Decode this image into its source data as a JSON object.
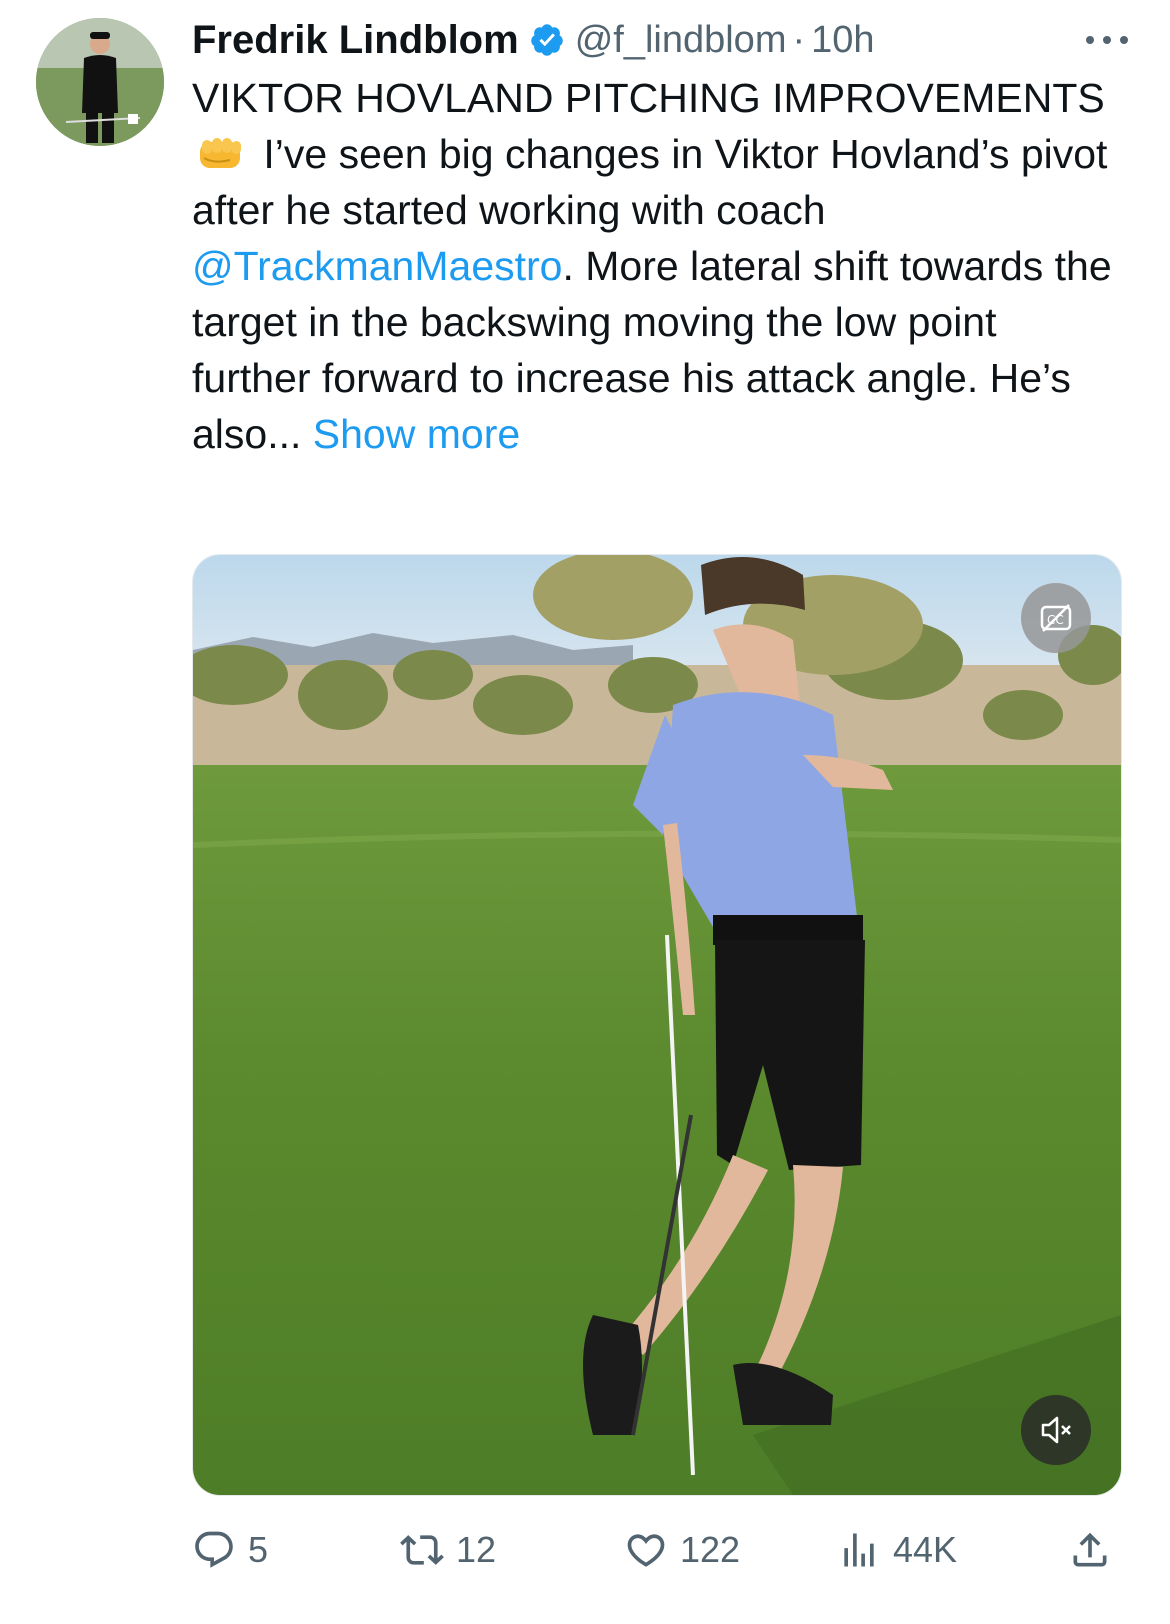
{
  "author": {
    "name": "Fredrik Lindblom",
    "handle": "@f_lindblom",
    "separator": "·",
    "time": "10h",
    "verified": true,
    "avatar_icon": "golfer-avatar"
  },
  "tweet": {
    "text_part1": "VIKTOR HOVLAND PITCHING IMPROVEMENTS",
    "emoji": "oncoming-fist-emoji",
    "text_part2": " I’ve seen big changes in Viktor Hovland’s pivot after he started working with coach ",
    "mention": "@TrackmanMaestro",
    "text_part3": ". More lateral shift towards the target in the backswing moving the low point further forward to increase his attack angle. He’s also... ",
    "show_more": "Show more"
  },
  "media": {
    "type": "video",
    "captions_icon": "captions-off-icon",
    "mute_icon": "speaker-muted-icon"
  },
  "actions": {
    "replies": "5",
    "retweets": "12",
    "likes": "122",
    "views": "44K"
  },
  "colors": {
    "link": "#1d9bf0",
    "secondary_text": "#536471",
    "verified_badge": "#1d9bf0"
  }
}
